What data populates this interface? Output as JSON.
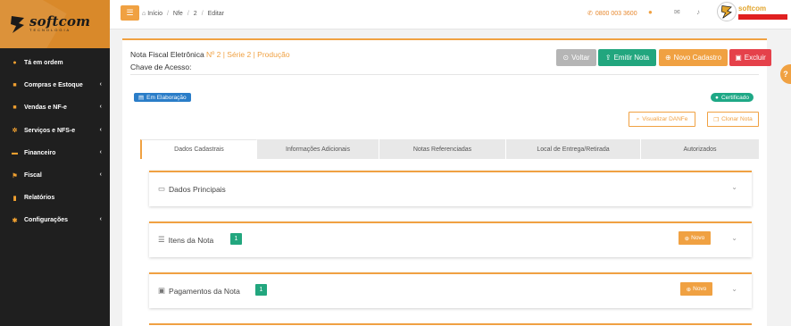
{
  "brand": {
    "name": "softcom",
    "sub": "TECNOLOGIA",
    "accent": "#f0a142"
  },
  "sidebar": {
    "items": [
      {
        "label": "Tá em ordem",
        "icon": "circle-icon",
        "has_submenu": false
      },
      {
        "label": "Compras e Estoque",
        "icon": "cart-icon",
        "has_submenu": true
      },
      {
        "label": "Vendas e NF-e",
        "icon": "truck-icon",
        "has_submenu": true
      },
      {
        "label": "Serviços e NFS-e",
        "icon": "gears-icon",
        "has_submenu": true
      },
      {
        "label": "Financeiro",
        "icon": "money-icon",
        "has_submenu": true
      },
      {
        "label": "Fiscal",
        "icon": "flag-icon",
        "has_submenu": true
      },
      {
        "label": "Relatórios",
        "icon": "chart-icon",
        "has_submenu": false
      },
      {
        "label": "Configurações",
        "icon": "gear-icon",
        "has_submenu": true
      }
    ]
  },
  "topbar": {
    "breadcrumb": [
      "Início",
      "Nfe",
      "2",
      "Editar"
    ],
    "phone": "0800 003 3600",
    "user_name": "softcom"
  },
  "nf": {
    "title": "Nota Fiscal Eletrônica",
    "subtitle": "Nº 2 | Série 2 | Produção",
    "chave_label": "Chave de Acesso:"
  },
  "actions": {
    "voltar": "Voltar",
    "emitir": "Emitir Nota",
    "novo_cadastro": "Novo Cadastro",
    "excluir": "Excluir"
  },
  "status": {
    "elaboracao": "Em Elaboração",
    "certificado": "Certificado"
  },
  "secondary_actions": {
    "danfe": "Visualizar DANFe",
    "clonar": "Clonar Nota"
  },
  "tabs": [
    "Dados Cadastrais",
    "Informações Adicionais",
    "Notas Referenciadas",
    "Local de Entrega/Retirada",
    "Autorizados"
  ],
  "sections": {
    "dados_principais": {
      "title": "Dados Principais"
    },
    "itens": {
      "title": "Itens da Nota",
      "count": "1",
      "novo": "Novo"
    },
    "pagamentos": {
      "title": "Pagamentos da Nota",
      "count": "1",
      "novo": "Novo"
    }
  },
  "help": "?"
}
